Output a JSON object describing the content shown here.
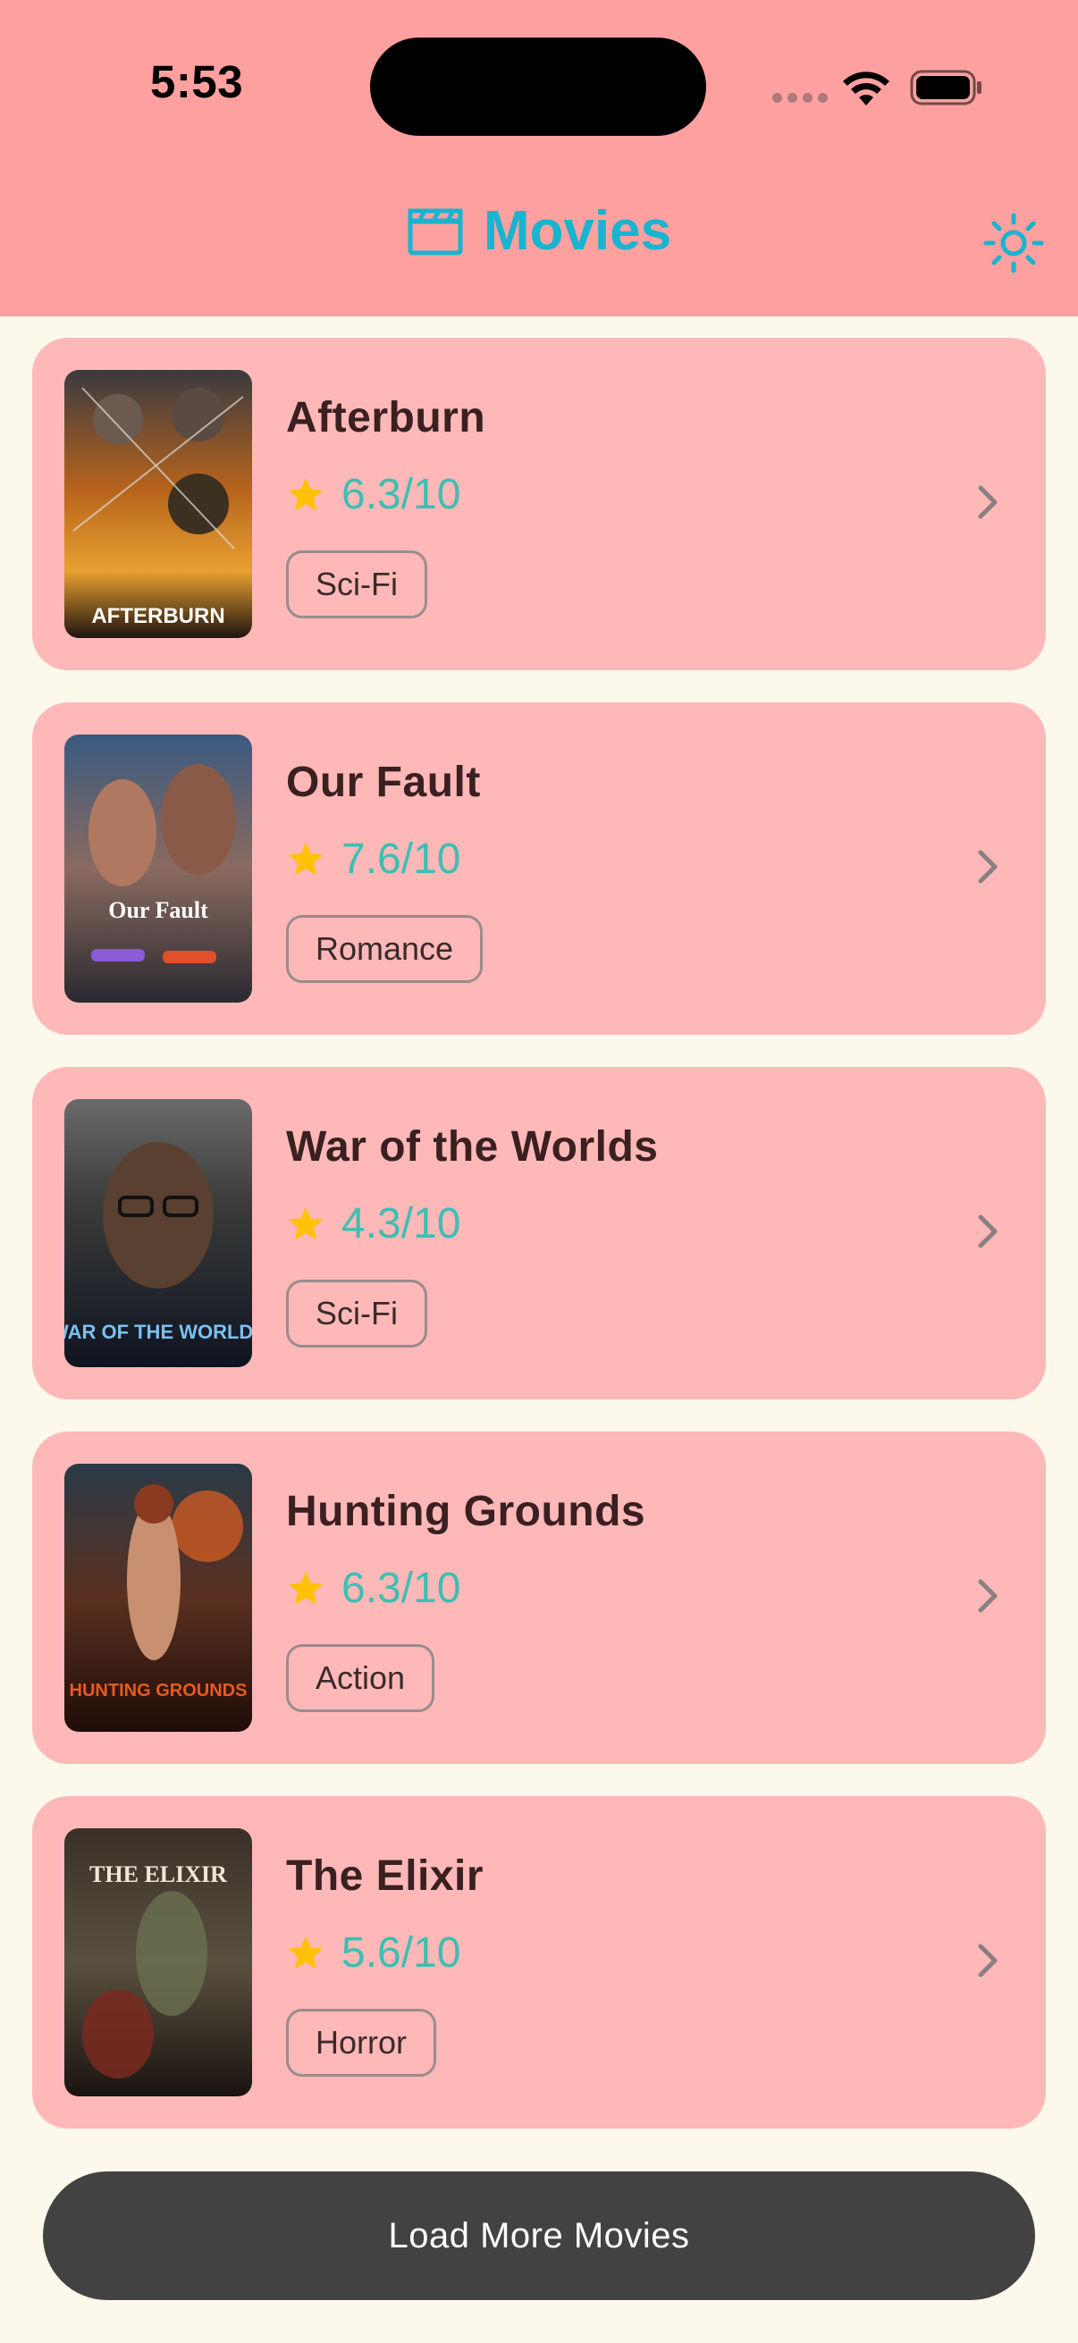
{
  "status_bar": {
    "time": "5:53"
  },
  "header": {
    "title": "Movies",
    "title_icon": "clapperboard-icon",
    "theme_toggle_icon": "sun-icon"
  },
  "colors": {
    "header_bg": "#ffa0a0",
    "page_bg": "#fcf8ec",
    "card_bg": "#ffb8b8",
    "accent": "#18b4d0",
    "rating": "#3cbfb3",
    "star": "#ffc107",
    "button_bg": "#424242"
  },
  "movies": [
    {
      "title": "Afterburn",
      "rating": "6.3/10",
      "genre": "Sci-Fi",
      "poster_text": "AFTERBURN"
    },
    {
      "title": "Our Fault",
      "rating": "7.6/10",
      "genre": "Romance",
      "poster_text": "Our Fault"
    },
    {
      "title": "War of the Worlds",
      "rating": "4.3/10",
      "genre": "Sci-Fi",
      "poster_text": "WAR OF THE WORLDS"
    },
    {
      "title": "Hunting Grounds",
      "rating": "6.3/10",
      "genre": "Action",
      "poster_text": "HUNTING GROUNDS"
    },
    {
      "title": "The Elixir",
      "rating": "5.6/10",
      "genre": "Horror",
      "poster_text": "THE ELIXIR"
    }
  ],
  "load_more_label": "Load More Movies"
}
